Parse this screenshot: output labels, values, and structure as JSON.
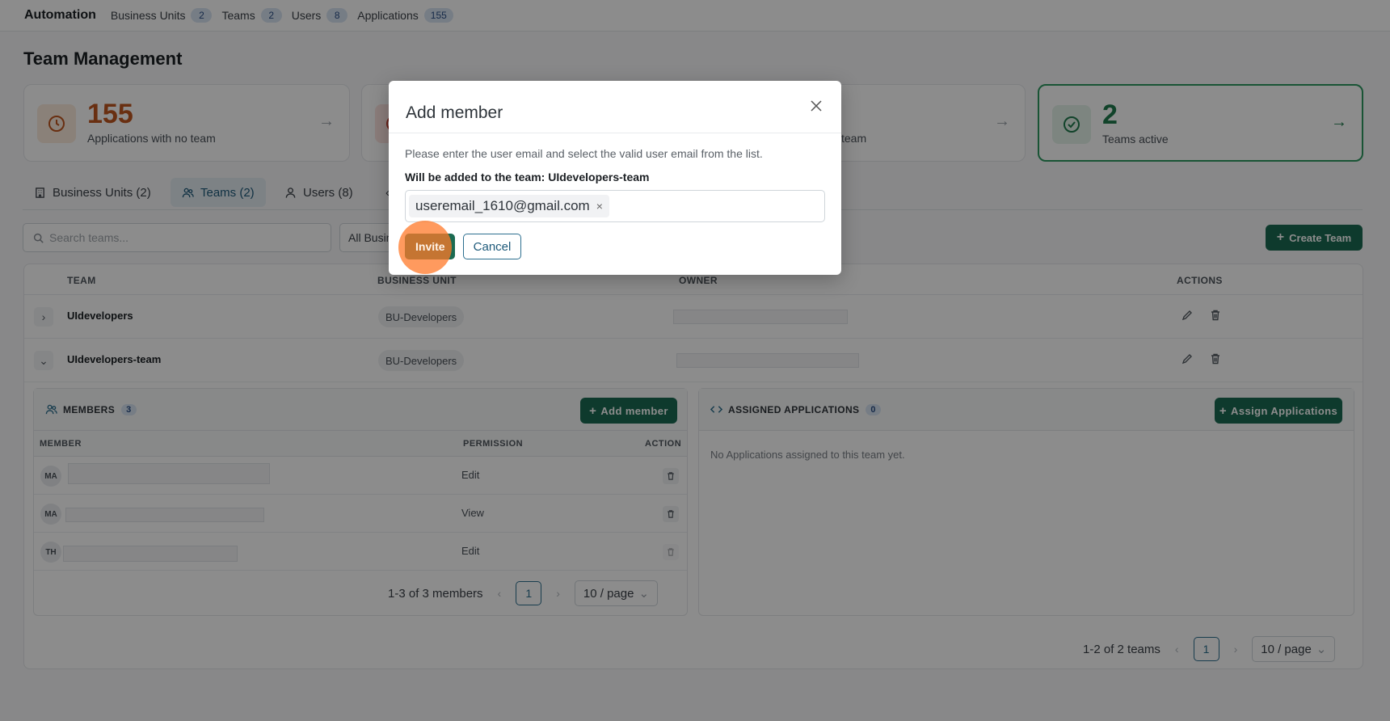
{
  "nav": {
    "brand": "Automation",
    "items": [
      {
        "label": "Business Units",
        "count": "2"
      },
      {
        "label": "Teams",
        "count": "2"
      },
      {
        "label": "Users",
        "count": "8"
      },
      {
        "label": "Applications",
        "count": "155"
      }
    ]
  },
  "page_title": "Team Management",
  "cards": [
    {
      "value": "155",
      "label": "Applications with no team",
      "color": "#c0561f"
    },
    {
      "value": "",
      "label": "",
      "color": "#c0392b"
    },
    {
      "value": "",
      "label": "team",
      "color": "#1b1f23"
    },
    {
      "value": "2",
      "label": "Teams active",
      "color": "#1f7a4d"
    }
  ],
  "tabs": [
    {
      "label": "Business Units (2)"
    },
    {
      "label": "Teams (2)"
    },
    {
      "label": "Users (8)"
    }
  ],
  "toolbar": {
    "search_placeholder": "Search teams...",
    "filter_label": "All Business Units",
    "create_label": "Create Team"
  },
  "table": {
    "headers": [
      "TEAM",
      "BUSINESS UNIT",
      "OWNER",
      "ACTIONS"
    ],
    "rows": [
      {
        "team": "UIdevelopers",
        "bu": "BU-Developers"
      },
      {
        "team": "UIdevelopers-team",
        "bu": "BU-Developers"
      }
    ],
    "pagination": {
      "summary": "1-2 of 2 teams",
      "page": "1",
      "page_size": "10 / page"
    }
  },
  "members": {
    "title": "MEMBERS",
    "count": "3",
    "add_label": "Add member",
    "headers": [
      "MEMBER",
      "PERMISSION",
      "ACTION"
    ],
    "rows": [
      {
        "initials": "MA",
        "permission": "Edit"
      },
      {
        "initials": "MA",
        "permission": "View"
      },
      {
        "initials": "TH",
        "permission": "Edit"
      }
    ],
    "pagination": {
      "summary": "1-3 of 3 members",
      "page": "1",
      "page_size": "10 / page"
    }
  },
  "apps": {
    "title": "ASSIGNED APPLICATIONS",
    "count": "0",
    "assign_label": "Assign Applications",
    "empty": "No Applications assigned to this team yet."
  },
  "modal": {
    "title": "Add member",
    "description": "Please enter the user email and select the valid user email from the list.",
    "team_line": "Will be added to the team: UIdevelopers-team",
    "chip": "useremail_1610@gmail.com",
    "invite_label": "Invite",
    "cancel_label": "Cancel"
  }
}
